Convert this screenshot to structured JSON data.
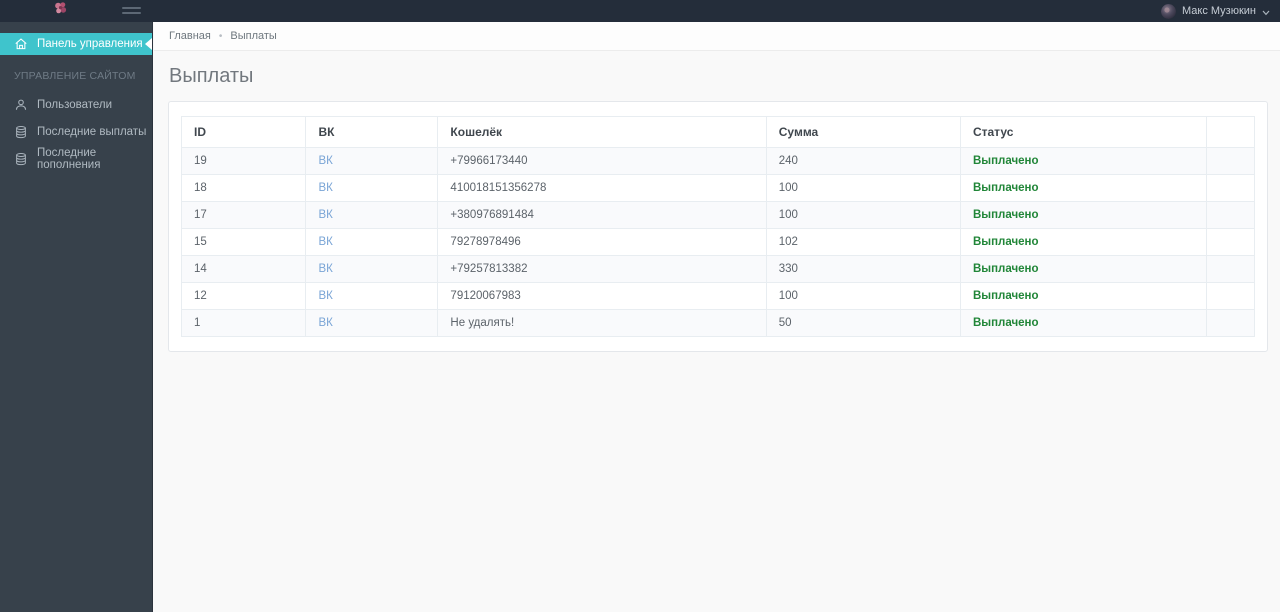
{
  "topbar": {
    "user_name": "Макс Музюкин"
  },
  "sidebar": {
    "active_item": {
      "label": "Панель управления"
    },
    "section_label": "УПРАВЛЕНИЕ САЙТОМ",
    "items": [
      {
        "label": "Пользователи"
      },
      {
        "label": "Последние выплаты"
      },
      {
        "label": "Последние пополнения"
      }
    ]
  },
  "breadcrumb": {
    "items": [
      "Главная",
      "Выплаты"
    ],
    "separator": "•"
  },
  "page": {
    "title": "Выплаты"
  },
  "table": {
    "columns": [
      "ID",
      "ВК",
      "Кошелёк",
      "Сумма",
      "Статус",
      ""
    ],
    "rows": [
      {
        "id": "19",
        "vk": "ВК",
        "wallet": "+79966173440",
        "amount": "240",
        "status": "Выплачено"
      },
      {
        "id": "18",
        "vk": "ВК",
        "wallet": "410018151356278",
        "amount": "100",
        "status": "Выплачено"
      },
      {
        "id": "17",
        "vk": "ВК",
        "wallet": "+380976891484",
        "amount": "100",
        "status": "Выплачено"
      },
      {
        "id": "15",
        "vk": "ВК",
        "wallet": "79278978496",
        "amount": "102",
        "status": "Выплачено"
      },
      {
        "id": "14",
        "vk": "ВК",
        "wallet": "+79257813382",
        "amount": "330",
        "status": "Выплачено"
      },
      {
        "id": "12",
        "vk": "ВК",
        "wallet": "79120067983",
        "amount": "100",
        "status": "Выплачено"
      },
      {
        "id": "1",
        "vk": "ВК",
        "wallet": "Не удалять!",
        "amount": "50",
        "status": "Выплачено"
      }
    ]
  },
  "colors": {
    "accent_teal": "#3fc4cc",
    "link_blue": "#7aa5d6",
    "status_green": "#218638",
    "topbar_bg": "#242d3a",
    "sidebar_bg": "#37414b"
  }
}
